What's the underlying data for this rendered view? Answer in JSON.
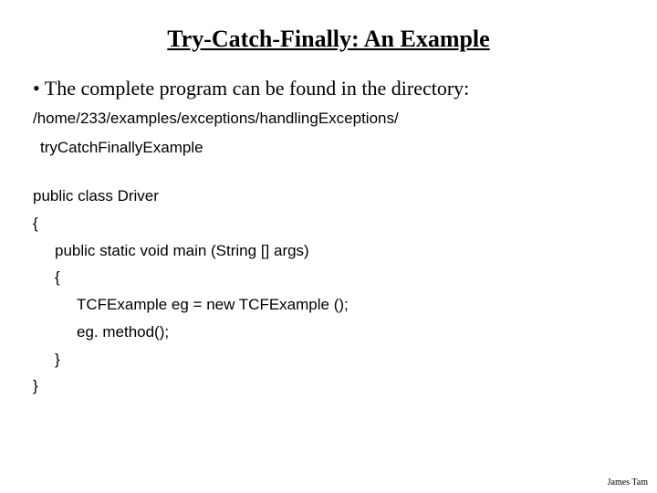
{
  "title": "Try-Catch-Finally: An Example",
  "bullet": "• The complete program can be found in the directory:",
  "path1": "/home/233/examples/exceptions/handlingExceptions/",
  "path2": "tryCatchFinallyExample",
  "code": {
    "l1": "public class Driver",
    "l2": "{",
    "l3": "public static void main (String [] args)",
    "l4": "{",
    "l5": "TCFExample eg = new TCFExample ();",
    "l6": "eg. method();",
    "l7": "}",
    "l8": "}"
  },
  "footer": "James Tam"
}
